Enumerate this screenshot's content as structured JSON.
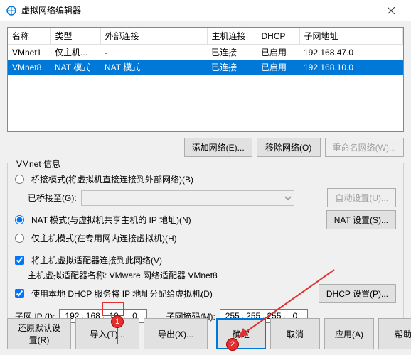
{
  "window": {
    "title": "虚拟网络编辑器"
  },
  "table": {
    "headers": {
      "name": "名称",
      "type": "类型",
      "ext": "外部连接",
      "host": "主机连接",
      "dhcp": "DHCP",
      "subnet": "子网地址"
    },
    "rows": [
      {
        "name": "VMnet1",
        "type": "仅主机...",
        "ext": "-",
        "host": "已连接",
        "dhcp": "已启用",
        "subnet": "192.168.47.0",
        "selected": false
      },
      {
        "name": "VMnet8",
        "type": "NAT 模式",
        "ext": "NAT 模式",
        "host": "已连接",
        "dhcp": "已启用",
        "subnet": "192.168.10.0",
        "selected": true
      }
    ]
  },
  "buttons": {
    "add_net": "添加网络(E)...",
    "remove_net": "移除网络(O)",
    "rename_net": "重命名网络(W)..."
  },
  "info": {
    "group_title": "VMnet 信息",
    "bridge_label": "桥接模式(将虚拟机直接连接到外部网络)(B)",
    "bridge_to_label": "已桥接至(G):",
    "bridge_auto": "自动设置(U)...",
    "nat_label": "NAT 模式(与虚拟机共享主机的 IP 地址)(N)",
    "nat_settings": "NAT 设置(S)...",
    "hostonly_label": "仅主机模式(在专用网内连接虚拟机)(H)",
    "host_adapter_label": "将主机虚拟适配器连接到此网络(V)",
    "host_adapter_name_label": "主机虚拟适配器名称: VMware 网络适配器 VMnet8",
    "dhcp_label": "使用本地 DHCP 服务将 IP 地址分配给虚拟机(D)",
    "dhcp_settings": "DHCP 设置(P)...",
    "subnet_ip_label": "子网 IP (I):",
    "subnet_mask_label": "子网掩码(M):",
    "subnet_ip": [
      "192",
      "168",
      "10",
      "0"
    ],
    "subnet_mask": [
      "255",
      "255",
      "255",
      "0"
    ]
  },
  "footer": {
    "restore": "还原默认设置(R)",
    "import": "导入(T)...",
    "export": "导出(X)...",
    "ok": "确定",
    "cancel": "取消",
    "apply": "应用(A)",
    "help": "帮助"
  },
  "annotations": {
    "badge1": "1",
    "badge2": "2"
  },
  "chart_data": {
    "type": "table",
    "title": "虚拟网络编辑器",
    "columns": [
      "名称",
      "类型",
      "外部连接",
      "主机连接",
      "DHCP",
      "子网地址"
    ],
    "rows": [
      [
        "VMnet1",
        "仅主机...",
        "-",
        "已连接",
        "已启用",
        "192.168.47.0"
      ],
      [
        "VMnet8",
        "NAT 模式",
        "NAT 模式",
        "已连接",
        "已启用",
        "192.168.10.0"
      ]
    ]
  }
}
